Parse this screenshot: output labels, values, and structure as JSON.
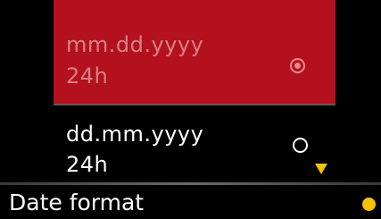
{
  "screen": {
    "title": "Date format"
  },
  "options": [
    {
      "line1": "mm.dd.yyyy",
      "line2": "24h",
      "selected": true
    },
    {
      "line1": "dd.mm.yyyy",
      "line2": "24h",
      "selected": false
    }
  ],
  "colors": {
    "background": "#000000",
    "selected_row": "#b3111d",
    "accent_yellow": "#f5c400",
    "text": "#ffffff",
    "selected_text": "#d88086"
  },
  "icons": {
    "scroll_indicator": "triangle-down-icon",
    "status_indicator": "dot-icon",
    "radio_selected": "radio-selected-icon",
    "radio_unselected": "radio-empty-icon"
  }
}
